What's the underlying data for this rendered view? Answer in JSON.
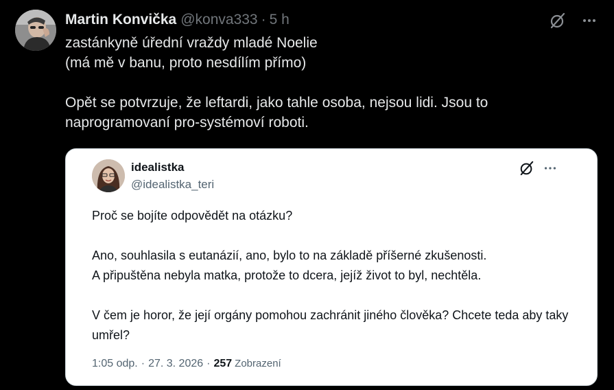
{
  "tweet": {
    "author": {
      "name": "Martin Konvička",
      "handle": "@konva333",
      "separator": "·",
      "time": "5 h",
      "avatar_icon": "user-avatar-photo"
    },
    "actions": {
      "grok_icon": "grok-icon",
      "more_icon": "more-options-icon",
      "more_label": "···"
    },
    "text": {
      "line1": "zastánkyně úřední vraždy mladé Noelie",
      "line2": "(má mě v banu, proto nesdílím přímo)",
      "line3": "Opět se potvrzuje, že leftardi, jako tahle osoba, nejsou lidi. Jsou to naprogramovaní pro-systémoví roboti."
    }
  },
  "quote": {
    "author": {
      "name": "idealistka",
      "handle": "@idealistka_teri",
      "avatar_icon": "user-avatar-photo"
    },
    "actions": {
      "grok_icon": "grok-icon",
      "more_icon": "more-options-icon",
      "more_label": "···"
    },
    "text": {
      "p1": "Proč se bojíte odpovědět na otázku?",
      "p2a": "Ano, souhlasila s eutanázií, ano, bylo to na základě příšerné zkušenosti.",
      "p2b": "A připuštěna nebyla matka, protože to dcera, jejíž život to byl, nechtěla.",
      "p3": "V čem je horor, že její orgány pomohou zachránit jiného člověka? Chcete teda aby taky umřel?"
    },
    "meta": {
      "time": "1:05 odp.",
      "sep1": "·",
      "date": "27. 3. 2026",
      "sep2": "·",
      "views": "257",
      "views_label": "Zobrazení"
    }
  },
  "colors": {
    "background": "#000000",
    "primary_text_dark": "#e7e9ea",
    "secondary_text_dark": "#71767b",
    "card_background": "#ffffff",
    "card_text": "#0f1419",
    "card_secondary_text": "#536471"
  }
}
